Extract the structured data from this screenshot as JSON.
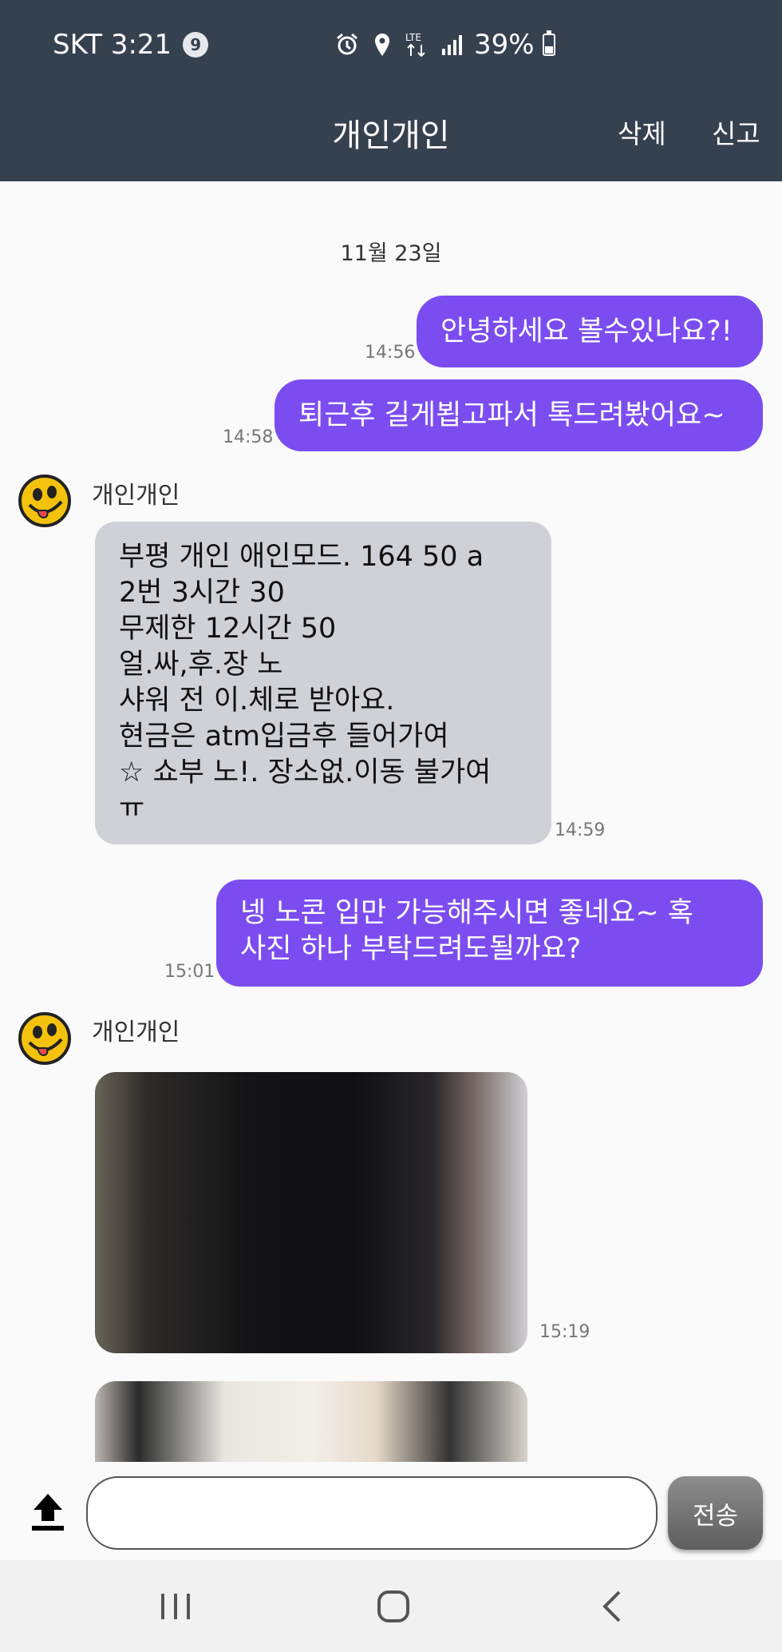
{
  "status_bar": {
    "carrier_time": "SKT 3:21",
    "notification_count": "9",
    "network": "LTE",
    "battery": "39%",
    "battery_level": 0.39
  },
  "header": {
    "title": "개인개인",
    "delete_label": "삭제",
    "report_label": "신고"
  },
  "chat": {
    "date": "11월 23일",
    "messages": [
      {
        "time": "14:56",
        "lines": [
          "안녕하세요 볼수있나요?!"
        ]
      },
      {
        "time": "14:58",
        "lines": [
          "퇴근후 길게뵙고파서 톡드려봤어요~"
        ]
      },
      {
        "sender": "개인개인",
        "time": "14:59",
        "lines": [
          "부평 개인 애인모드. 164 50 a",
          "2번 3시간 30",
          "무제한 12시간 50",
          "얼.싸,후.장 노",
          "샤워 전 이.체로 받아요.",
          "현금은 atm입금후 들어가여",
          "☆ 쇼부 노!. 장소없.이동 불가여",
          "ㅠ"
        ]
      },
      {
        "time": "15:01",
        "lines": [
          "넹 노콘 입만 가능해주시면 좋네요~ 혹",
          "사진 하나 부탁드려도될까요?"
        ]
      },
      {
        "sender": "개인개인",
        "time": "15:19"
      }
    ]
  },
  "input": {
    "placeholder": "",
    "send_label": "전송"
  },
  "colors": {
    "header_bg": "#364150",
    "outgoing_bubble": "#7b4df0",
    "incoming_bubble": "#cfd1d6"
  }
}
